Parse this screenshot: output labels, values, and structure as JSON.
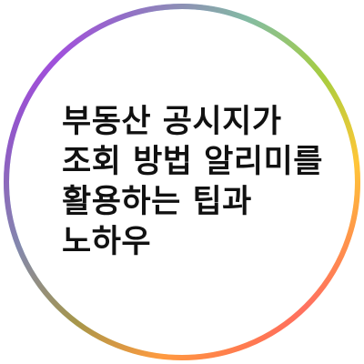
{
  "title_lines": [
    "부동산 공시지가",
    "조회 방법 알리미를",
    "활용하는 팁과",
    "노하우"
  ],
  "ring": {
    "colors": [
      "#ff3b3b",
      "#ff9a1f",
      "#ffe81a",
      "#5ee03a",
      "#1fc7e8",
      "#3a6bff",
      "#b43bff",
      "#ff3bb0"
    ]
  }
}
